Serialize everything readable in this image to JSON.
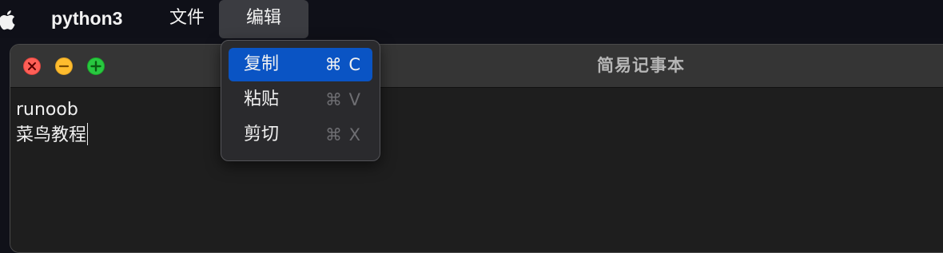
{
  "menubar": {
    "apple_icon": "apple-logo-icon",
    "app_name": "python3",
    "file_menu": "文件",
    "edit_menu": "编辑"
  },
  "edit_menu_dropdown": {
    "items": [
      {
        "label": "复制",
        "shortcut": "⌘ C",
        "selected": true,
        "enabled": true
      },
      {
        "label": "粘贴",
        "shortcut": "⌘ V",
        "selected": false,
        "enabled": true
      },
      {
        "label": "剪切",
        "shortcut": "⌘ X",
        "selected": false,
        "enabled": true
      }
    ]
  },
  "window": {
    "title": "简易记事本",
    "traffic_lights": [
      "close-icon",
      "minimize-icon",
      "maximize-icon"
    ]
  },
  "editor": {
    "lines": [
      "runoob",
      "菜鸟教程"
    ]
  },
  "colors": {
    "selection_blue": "#0a54c4",
    "close_red": "#ff5f57",
    "minimize_yellow": "#febc2e",
    "maximize_green": "#28c840"
  }
}
